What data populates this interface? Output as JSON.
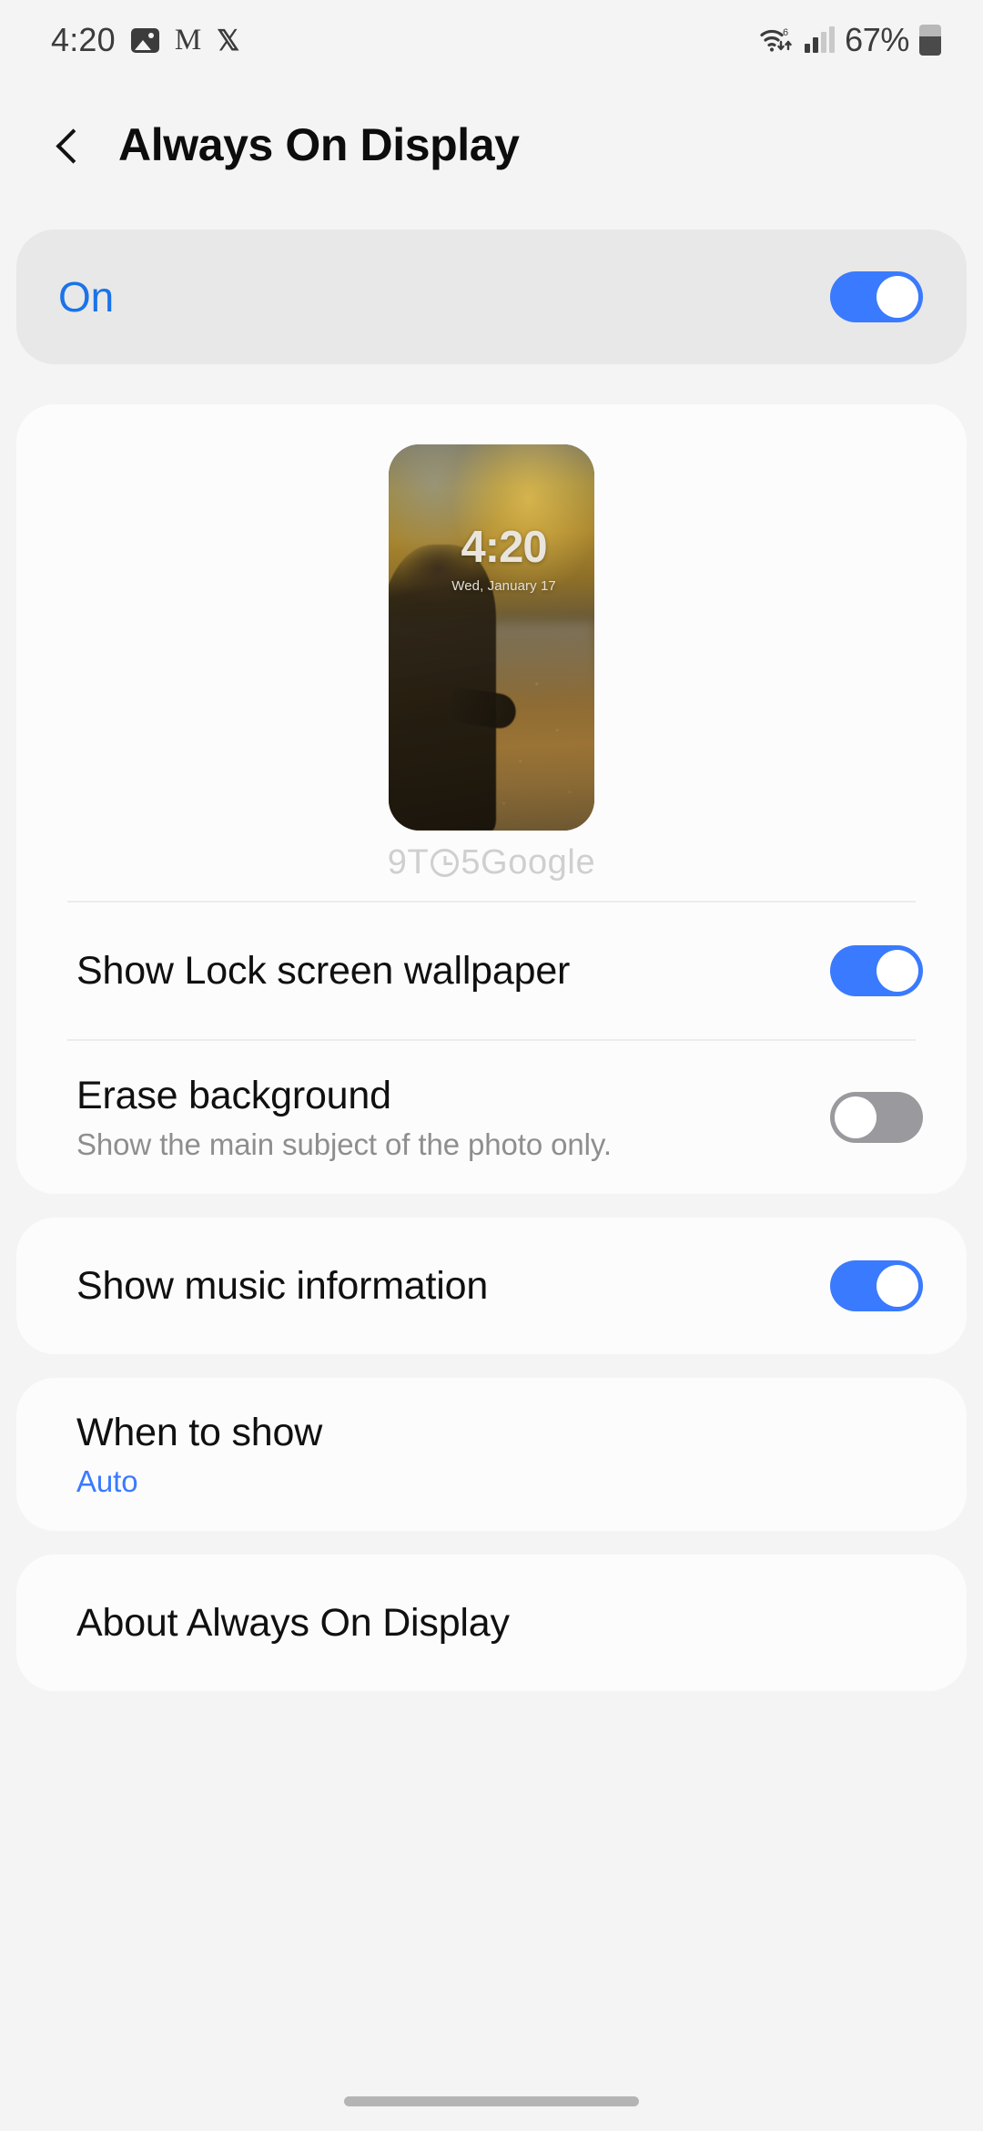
{
  "status_bar": {
    "time": "4:20",
    "left_icons": [
      "photos-icon",
      "gmail-icon",
      "x-app-icon"
    ],
    "wifi": "wifi-6-icon",
    "wifi_generation": "6",
    "signal": "cellular-signal-icon",
    "battery_percent": "67%",
    "battery_icon": "battery-icon"
  },
  "header": {
    "back_icon": "back-chevron-icon",
    "title": "Always On Display"
  },
  "master_switch": {
    "label": "On",
    "state": "on",
    "accent_color": "#1a73e8"
  },
  "preview": {
    "lock_time": "4:20",
    "lock_date": "Wed, January 17",
    "watermark_prefix": "9T",
    "watermark_suffix": "5Google",
    "watermark_icon": "clock-icon"
  },
  "settings_group_1": [
    {
      "title": "Show Lock screen wallpaper",
      "subtitle": "",
      "control": "toggle",
      "state": "on"
    },
    {
      "title": "Erase background",
      "subtitle": "Show the main subject of the photo only.",
      "control": "toggle",
      "state": "off"
    }
  ],
  "settings_group_2": [
    {
      "title": "Show music information",
      "subtitle": "",
      "control": "toggle",
      "state": "on"
    }
  ],
  "settings_group_3": [
    {
      "title": "When to show",
      "subtitle": "Auto",
      "control": "navigation"
    }
  ],
  "settings_group_4": [
    {
      "title": "About Always On Display",
      "subtitle": "",
      "control": "navigation"
    }
  ],
  "colors": {
    "toggle_on": "#3a7afe",
    "toggle_off": "#9a9a9e",
    "accent_blue": "#3a7afe",
    "page_background": "#f4f4f4",
    "card_background": "#fcfcfc",
    "master_card_background": "#e8e8e8"
  }
}
